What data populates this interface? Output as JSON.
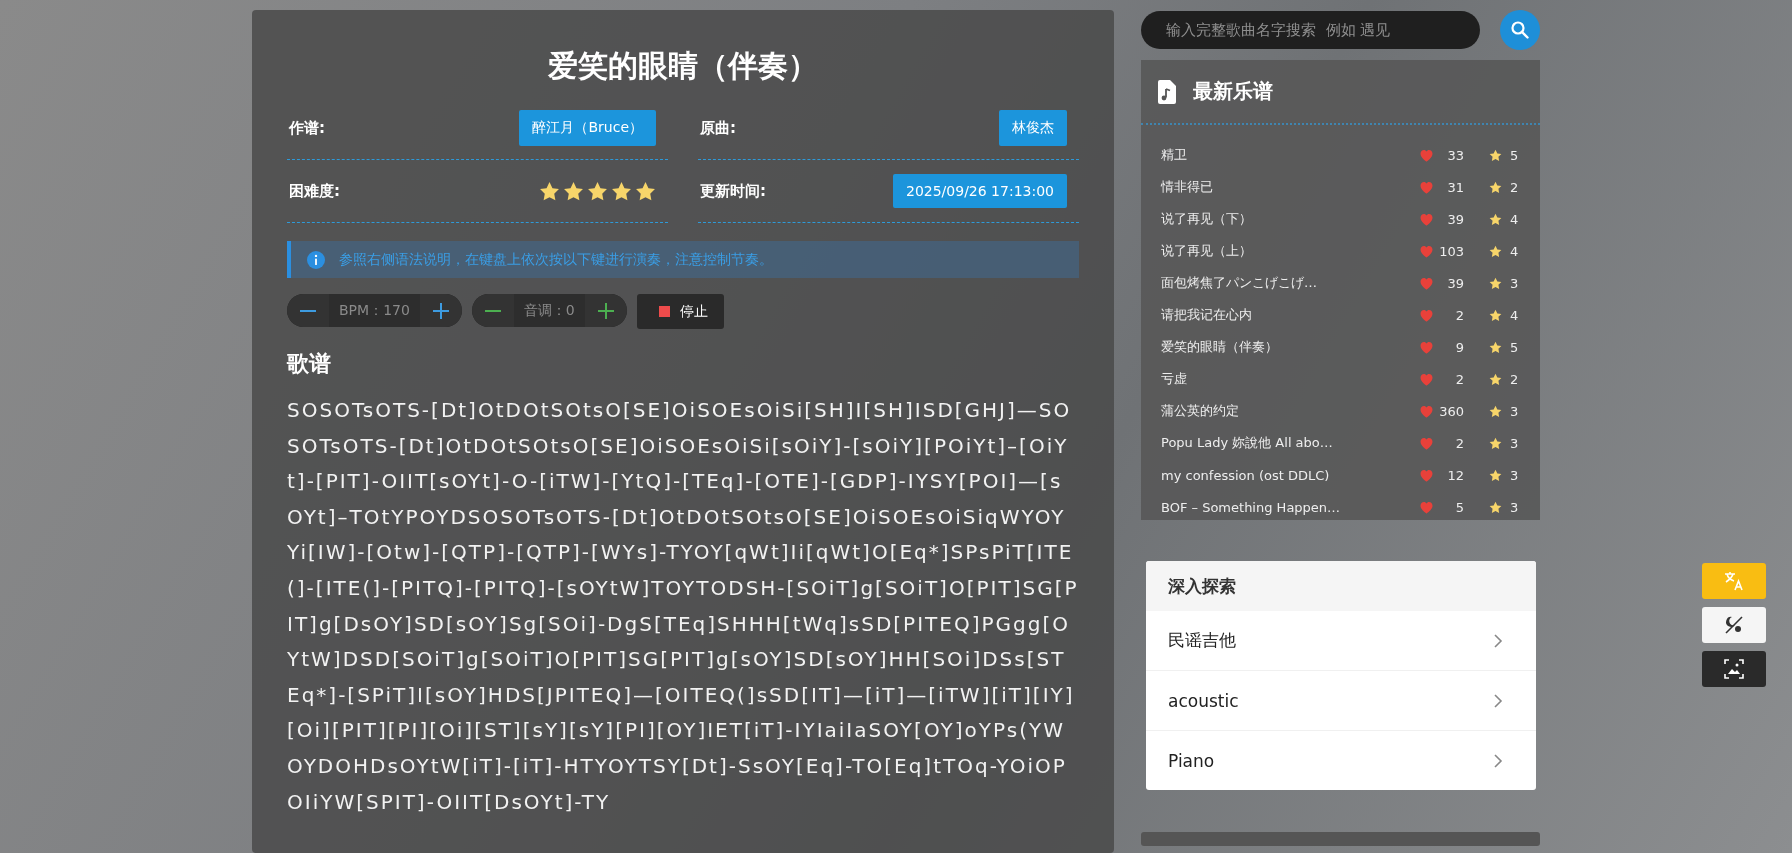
{
  "song": {
    "title": "爱笑的眼睛（伴奏）",
    "meta": [
      {
        "kind": "badge",
        "label": "作谱:",
        "value": "醉江月（Bruce）"
      },
      {
        "kind": "badge",
        "label": "原曲:",
        "value": "林俊杰"
      },
      {
        "kind": "stars",
        "label": "困难度:",
        "stars": 5
      },
      {
        "kind": "badge",
        "label": "更新时间:",
        "value": "2025/09/26 17:13:00"
      }
    ],
    "notice": "参照右侧语法说明，在键盘上依次按以下键进行演奏，注意控制节奏。",
    "controls": [
      {
        "kind": "stepper",
        "label": "BPM：170",
        "color": "#3d9be0"
      },
      {
        "kind": "stepper",
        "label": "音调：0",
        "color": "#4caf50"
      },
      {
        "kind": "stop",
        "label": "停止"
      }
    ],
    "sheet_heading": "歌谱",
    "sheet": "SOSOTsOTS-[Dt]OtDOtSOtsO[SE]OiSOEsOiSi[SH]I[SH]ISD[GHJ]—SOSOTsOTS-[Dt]OtDOtSOtsO[SE]OiSOEsOiSi[sOiY]-[sOiY][POiYt]–[OiYt]-[PIT]-OIIT[sOYt]-O-[iTW]-[YtQ]-[TEq]-[OTE]-[GDP]-IYSY[POI]—[sOYt]–TOtYPOYDSOSOTsOTS-[Dt]OtDOtSOtsO[SE]OiSOEsOiSiqWYOYYi[IW]-[Otw]-[QTP]-[QTP]-[WYs]-TYOY[qWt]Ii[qWt]O[Eq*]SPsPiT[ITE(]-[ITE(]-[PITQ]-[PITQ]-[sOYtW]TOYTODSH-[SOiT]g[SOiT]O[PIT]SG[PIT]g[DsOY]SD[sOY]Sg[SOi]-DgS[TEq]SHHH[tWq]sSD[PITEQ]PGgg[OYtW]DSD[SOiT]g[SOiT]O[PIT]SG[PIT]g[sOY]SD[sOY]HH[SOi]DSs[STEq*]-[SPiT]I[sOY]HDS[JPITEQ]—[OITEQ(]sSD[IT]—[iT]—[iTW][iT][IY][Oi][PIT][PI][Oi][ST][sY][sY][PI][OY]IET[iT]-IYIaiIaSOY[OY]oYPs(YWOYDOHDsOYtW[iT]-[iT]-HTYOYTSY[Dt]-SsOY[Eq]-TO[Eq]tTOq-YOiOPOIiYW[SPIT]-OIIT[DsOYt]-TY"
  },
  "search": {
    "placeholder": "输入完整歌曲名字搜索  例如 遇见"
  },
  "latest": {
    "title": "最新乐谱",
    "items": [
      {
        "name": "精卫",
        "likes": "33",
        "rating": "5"
      },
      {
        "name": "情非得已",
        "likes": "31",
        "rating": "2"
      },
      {
        "name": "说了再见（下）",
        "likes": "39",
        "rating": "4"
      },
      {
        "name": "说了再见（上）",
        "likes": "103",
        "rating": "4"
      },
      {
        "name": "面包烤焦了パンこげこげ…",
        "likes": "39",
        "rating": "3"
      },
      {
        "name": "请把我记在心内",
        "likes": "2",
        "rating": "4"
      },
      {
        "name": "爱笑的眼睛（伴奏）",
        "likes": "9",
        "rating": "5"
      },
      {
        "name": "亏虚",
        "likes": "2",
        "rating": "2"
      },
      {
        "name": "蒲公英的约定",
        "likes": "360",
        "rating": "3"
      },
      {
        "name": "Popu Lady 妳說他 All abo…",
        "likes": "2",
        "rating": "3"
      },
      {
        "name": "my confession (ost DDLC)",
        "likes": "12",
        "rating": "3"
      },
      {
        "name": "BOF – Something Happen…",
        "likes": "5",
        "rating": "3"
      }
    ]
  },
  "explore": {
    "title": "深入探索",
    "items": [
      "民谣吉他",
      "acoustic",
      "Piano"
    ]
  },
  "float_buttons": [
    {
      "kind": "translate"
    },
    {
      "kind": "theme"
    },
    {
      "kind": "screenshot"
    }
  ]
}
